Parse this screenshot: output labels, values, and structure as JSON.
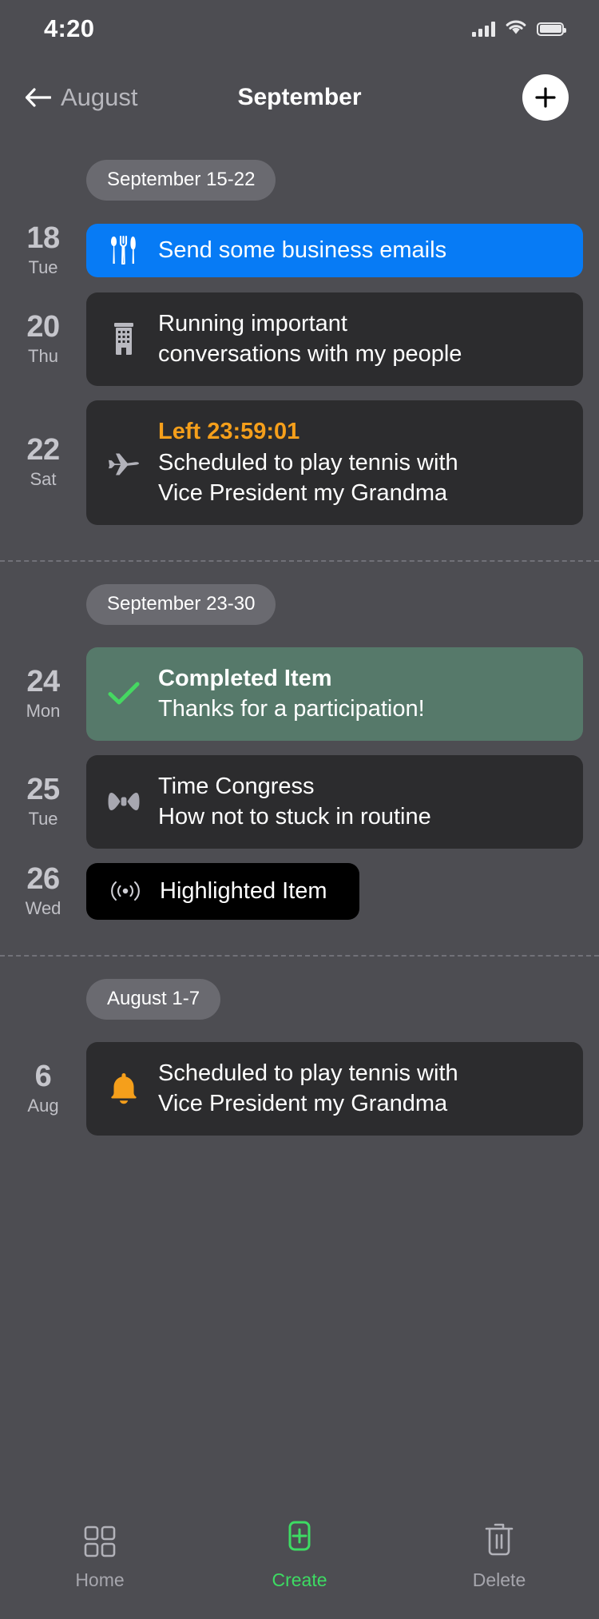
{
  "status_bar": {
    "time": "4:20",
    "signal_icon": "cellular-signal-icon",
    "wifi_icon": "wifi-icon",
    "battery_icon": "battery-full-icon"
  },
  "header": {
    "back_icon": "arrow-left-icon",
    "back_label": "August",
    "title": "September",
    "add_icon": "plus-icon"
  },
  "sections": [
    {
      "chip": "September 15-22",
      "events": [
        {
          "day": "18",
          "weekday": "Tue",
          "icon": "cutlery-icon",
          "style": "blue",
          "lines": [
            {
              "text": "Send some business emails",
              "kind": "normal"
            }
          ]
        },
        {
          "day": "20",
          "weekday": "Thu",
          "icon": "office-building-icon",
          "style": "dark",
          "lines": [
            {
              "text": "Running important",
              "kind": "normal"
            },
            {
              "text": "conversations with my people",
              "kind": "normal"
            }
          ]
        },
        {
          "day": "22",
          "weekday": "Sat",
          "icon": "airplane-icon",
          "style": "dark",
          "lines": [
            {
              "text": "Left 23:59:01",
              "kind": "accent"
            },
            {
              "text": "Scheduled to play tennis with",
              "kind": "normal"
            },
            {
              "text": "Vice President my Grandma",
              "kind": "normal"
            }
          ]
        }
      ]
    },
    {
      "chip": "September 23-30",
      "events": [
        {
          "day": "24",
          "weekday": "Mon",
          "icon": "check-icon",
          "style": "green",
          "lines": [
            {
              "text": "Completed Item",
              "kind": "bold"
            },
            {
              "text": "Thanks for a participation!",
              "kind": "normal"
            }
          ]
        },
        {
          "day": "25",
          "weekday": "Tue",
          "icon": "bowtie-icon",
          "style": "dark",
          "lines": [
            {
              "text": "Time Congress",
              "kind": "normal"
            },
            {
              "text": "How not to stuck in routine",
              "kind": "normal"
            }
          ]
        },
        {
          "day": "26",
          "weekday": "Wed",
          "icon": "broadcast-icon",
          "style": "black",
          "lines": [
            {
              "text": "Highlighted Item",
              "kind": "normal"
            }
          ]
        }
      ]
    },
    {
      "chip": "August 1-7",
      "events": [
        {
          "day": "6",
          "weekday": "Aug",
          "icon": "bell-icon",
          "style": "dark",
          "lines": [
            {
              "text": "Scheduled to play tennis with",
              "kind": "normal"
            },
            {
              "text": "Vice President my Grandma",
              "kind": "normal"
            }
          ]
        }
      ]
    }
  ],
  "tabbar": {
    "items": [
      {
        "label": "Home",
        "icon": "grid-icon",
        "active": false
      },
      {
        "label": "Create",
        "icon": "plus-square-icon",
        "active": true
      },
      {
        "label": "Delete",
        "icon": "trash-icon",
        "active": false
      }
    ]
  },
  "colors": {
    "background": "#4d4d52",
    "card_dark": "#2c2c2e",
    "card_blue": "#077bf5",
    "card_green": "#56796a",
    "card_black": "#000000",
    "accent_orange": "#f59f1b",
    "accent_green": "#3ddc63",
    "chip": "#6a6a70"
  }
}
